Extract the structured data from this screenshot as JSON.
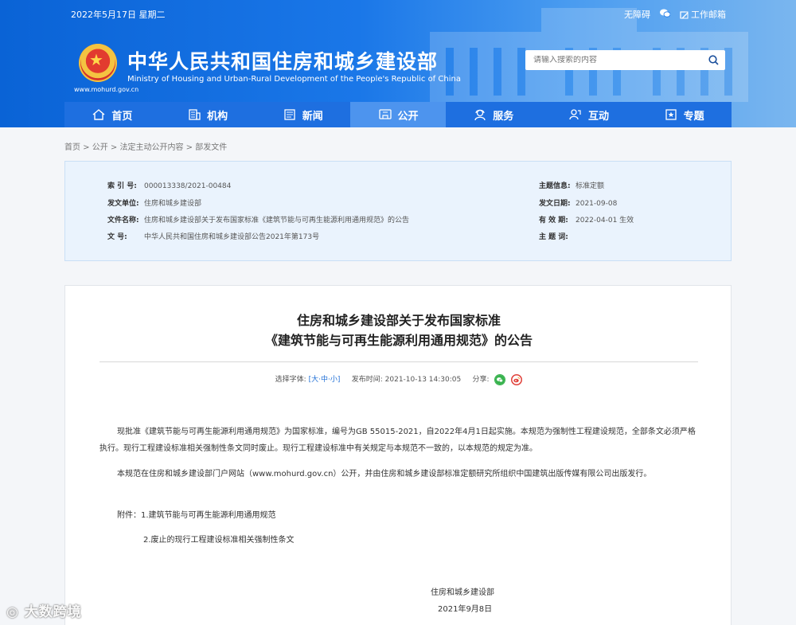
{
  "topbar": {
    "date": "2022年5月17日 星期二",
    "accessibility": "无障碍",
    "mail": "工作邮箱"
  },
  "site": {
    "title": "中华人民共和国住房和城乡建设部",
    "subtitle": "Ministry of Housing and Urban-Rural Development of the People's Republic of China",
    "url": "www.mohurd.gov.cn"
  },
  "search": {
    "placeholder": "请输入搜索的内容"
  },
  "nav": [
    {
      "label": "首页",
      "icon": "home-icon"
    },
    {
      "label": "机构",
      "icon": "building-icon"
    },
    {
      "label": "新闻",
      "icon": "news-icon"
    },
    {
      "label": "公开",
      "icon": "public-icon"
    },
    {
      "label": "服务",
      "icon": "service-icon"
    },
    {
      "label": "互动",
      "icon": "interact-icon"
    },
    {
      "label": "专题",
      "icon": "topic-icon"
    }
  ],
  "breadcrumb": [
    "首页",
    "公开",
    "法定主动公开内容",
    "部发文件"
  ],
  "info": {
    "index_k": "索 引 号:",
    "index_v": "000013338/2021-00484",
    "unit_k": "发文单位:",
    "unit_v": "住房和城乡建设部",
    "name_k": "文件名称:",
    "name_v": "住房和城乡建设部关于发布国家标准《建筑节能与可再生能源利用通用规范》的公告",
    "doc_k": "文 号:",
    "doc_v": "中华人民共和国住房和城乡建设部公告2021年第173号",
    "subject_k": "主题信息:",
    "subject_v": "标准定额",
    "date_k": "发文日期:",
    "date_v": "2021-09-08",
    "valid_k": "有 效 期:",
    "valid_v": "2022-04-01 生效",
    "keyword_k": "主 题 词:",
    "keyword_v": ""
  },
  "article": {
    "title_line1": "住房和城乡建设部关于发布国家标准",
    "title_line2": "《建筑节能与可再生能源利用通用规范》的公告",
    "font_label": "选择字体:",
    "font_open": "[",
    "font_large": "大",
    "font_mid": "中",
    "font_small": "小",
    "font_close": "]",
    "publish_label": "发布时间:",
    "publish_time": "2021-10-13 14:30:05",
    "share_label": "分享:",
    "p1": "现批准《建筑节能与可再生能源利用通用规范》为国家标准，编号为GB 55015-2021，自2022年4月1日起实施。本规范为强制性工程建设规范，全部条文必须严格执行。现行工程建设标准相关强制性条文同时废止。现行工程建设标准中有关规定与本规范不一致的，以本规范的规定为准。",
    "p2": "本规范在住房和城乡建设部门户网站（www.mohurd.gov.cn）公开，并由住房和城乡建设部标准定额研究所组织中国建筑出版传媒有限公司出版发行。",
    "attach1": "附件：1.建筑节能与可再生能源利用通用规范",
    "attach2": "2.废止的现行工程建设标准相关强制性条文",
    "signer": "住房和城乡建设部",
    "sign_date": "2021年9月8日"
  },
  "watermark": "大数跨境"
}
